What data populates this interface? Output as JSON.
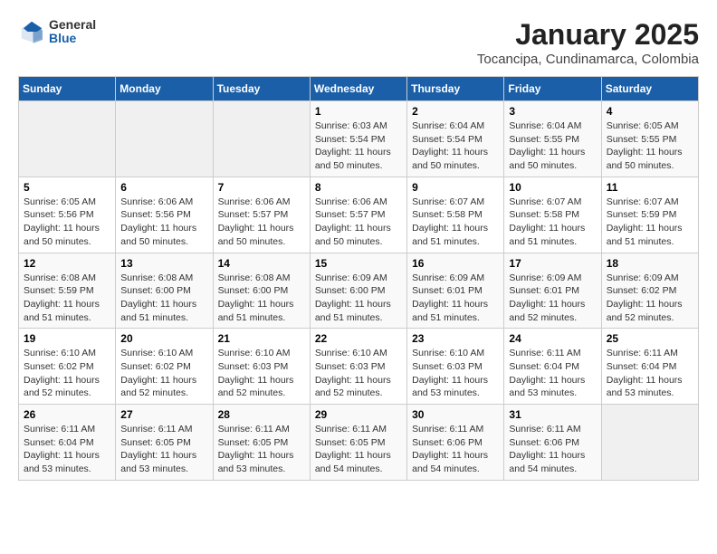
{
  "header": {
    "logo_general": "General",
    "logo_blue": "Blue",
    "month_title": "January 2025",
    "location": "Tocancipa, Cundinamarca, Colombia"
  },
  "days_of_week": [
    "Sunday",
    "Monday",
    "Tuesday",
    "Wednesday",
    "Thursday",
    "Friday",
    "Saturday"
  ],
  "weeks": [
    [
      {
        "day": "",
        "sunrise": "",
        "sunset": "",
        "daylight": ""
      },
      {
        "day": "",
        "sunrise": "",
        "sunset": "",
        "daylight": ""
      },
      {
        "day": "",
        "sunrise": "",
        "sunset": "",
        "daylight": ""
      },
      {
        "day": "1",
        "sunrise": "Sunrise: 6:03 AM",
        "sunset": "Sunset: 5:54 PM",
        "daylight": "Daylight: 11 hours and 50 minutes."
      },
      {
        "day": "2",
        "sunrise": "Sunrise: 6:04 AM",
        "sunset": "Sunset: 5:54 PM",
        "daylight": "Daylight: 11 hours and 50 minutes."
      },
      {
        "day": "3",
        "sunrise": "Sunrise: 6:04 AM",
        "sunset": "Sunset: 5:55 PM",
        "daylight": "Daylight: 11 hours and 50 minutes."
      },
      {
        "day": "4",
        "sunrise": "Sunrise: 6:05 AM",
        "sunset": "Sunset: 5:55 PM",
        "daylight": "Daylight: 11 hours and 50 minutes."
      }
    ],
    [
      {
        "day": "5",
        "sunrise": "Sunrise: 6:05 AM",
        "sunset": "Sunset: 5:56 PM",
        "daylight": "Daylight: 11 hours and 50 minutes."
      },
      {
        "day": "6",
        "sunrise": "Sunrise: 6:06 AM",
        "sunset": "Sunset: 5:56 PM",
        "daylight": "Daylight: 11 hours and 50 minutes."
      },
      {
        "day": "7",
        "sunrise": "Sunrise: 6:06 AM",
        "sunset": "Sunset: 5:57 PM",
        "daylight": "Daylight: 11 hours and 50 minutes."
      },
      {
        "day": "8",
        "sunrise": "Sunrise: 6:06 AM",
        "sunset": "Sunset: 5:57 PM",
        "daylight": "Daylight: 11 hours and 50 minutes."
      },
      {
        "day": "9",
        "sunrise": "Sunrise: 6:07 AM",
        "sunset": "Sunset: 5:58 PM",
        "daylight": "Daylight: 11 hours and 51 minutes."
      },
      {
        "day": "10",
        "sunrise": "Sunrise: 6:07 AM",
        "sunset": "Sunset: 5:58 PM",
        "daylight": "Daylight: 11 hours and 51 minutes."
      },
      {
        "day": "11",
        "sunrise": "Sunrise: 6:07 AM",
        "sunset": "Sunset: 5:59 PM",
        "daylight": "Daylight: 11 hours and 51 minutes."
      }
    ],
    [
      {
        "day": "12",
        "sunrise": "Sunrise: 6:08 AM",
        "sunset": "Sunset: 5:59 PM",
        "daylight": "Daylight: 11 hours and 51 minutes."
      },
      {
        "day": "13",
        "sunrise": "Sunrise: 6:08 AM",
        "sunset": "Sunset: 6:00 PM",
        "daylight": "Daylight: 11 hours and 51 minutes."
      },
      {
        "day": "14",
        "sunrise": "Sunrise: 6:08 AM",
        "sunset": "Sunset: 6:00 PM",
        "daylight": "Daylight: 11 hours and 51 minutes."
      },
      {
        "day": "15",
        "sunrise": "Sunrise: 6:09 AM",
        "sunset": "Sunset: 6:00 PM",
        "daylight": "Daylight: 11 hours and 51 minutes."
      },
      {
        "day": "16",
        "sunrise": "Sunrise: 6:09 AM",
        "sunset": "Sunset: 6:01 PM",
        "daylight": "Daylight: 11 hours and 51 minutes."
      },
      {
        "day": "17",
        "sunrise": "Sunrise: 6:09 AM",
        "sunset": "Sunset: 6:01 PM",
        "daylight": "Daylight: 11 hours and 52 minutes."
      },
      {
        "day": "18",
        "sunrise": "Sunrise: 6:09 AM",
        "sunset": "Sunset: 6:02 PM",
        "daylight": "Daylight: 11 hours and 52 minutes."
      }
    ],
    [
      {
        "day": "19",
        "sunrise": "Sunrise: 6:10 AM",
        "sunset": "Sunset: 6:02 PM",
        "daylight": "Daylight: 11 hours and 52 minutes."
      },
      {
        "day": "20",
        "sunrise": "Sunrise: 6:10 AM",
        "sunset": "Sunset: 6:02 PM",
        "daylight": "Daylight: 11 hours and 52 minutes."
      },
      {
        "day": "21",
        "sunrise": "Sunrise: 6:10 AM",
        "sunset": "Sunset: 6:03 PM",
        "daylight": "Daylight: 11 hours and 52 minutes."
      },
      {
        "day": "22",
        "sunrise": "Sunrise: 6:10 AM",
        "sunset": "Sunset: 6:03 PM",
        "daylight": "Daylight: 11 hours and 52 minutes."
      },
      {
        "day": "23",
        "sunrise": "Sunrise: 6:10 AM",
        "sunset": "Sunset: 6:03 PM",
        "daylight": "Daylight: 11 hours and 53 minutes."
      },
      {
        "day": "24",
        "sunrise": "Sunrise: 6:11 AM",
        "sunset": "Sunset: 6:04 PM",
        "daylight": "Daylight: 11 hours and 53 minutes."
      },
      {
        "day": "25",
        "sunrise": "Sunrise: 6:11 AM",
        "sunset": "Sunset: 6:04 PM",
        "daylight": "Daylight: 11 hours and 53 minutes."
      }
    ],
    [
      {
        "day": "26",
        "sunrise": "Sunrise: 6:11 AM",
        "sunset": "Sunset: 6:04 PM",
        "daylight": "Daylight: 11 hours and 53 minutes."
      },
      {
        "day": "27",
        "sunrise": "Sunrise: 6:11 AM",
        "sunset": "Sunset: 6:05 PM",
        "daylight": "Daylight: 11 hours and 53 minutes."
      },
      {
        "day": "28",
        "sunrise": "Sunrise: 6:11 AM",
        "sunset": "Sunset: 6:05 PM",
        "daylight": "Daylight: 11 hours and 53 minutes."
      },
      {
        "day": "29",
        "sunrise": "Sunrise: 6:11 AM",
        "sunset": "Sunset: 6:05 PM",
        "daylight": "Daylight: 11 hours and 54 minutes."
      },
      {
        "day": "30",
        "sunrise": "Sunrise: 6:11 AM",
        "sunset": "Sunset: 6:06 PM",
        "daylight": "Daylight: 11 hours and 54 minutes."
      },
      {
        "day": "31",
        "sunrise": "Sunrise: 6:11 AM",
        "sunset": "Sunset: 6:06 PM",
        "daylight": "Daylight: 11 hours and 54 minutes."
      },
      {
        "day": "",
        "sunrise": "",
        "sunset": "",
        "daylight": ""
      }
    ]
  ]
}
